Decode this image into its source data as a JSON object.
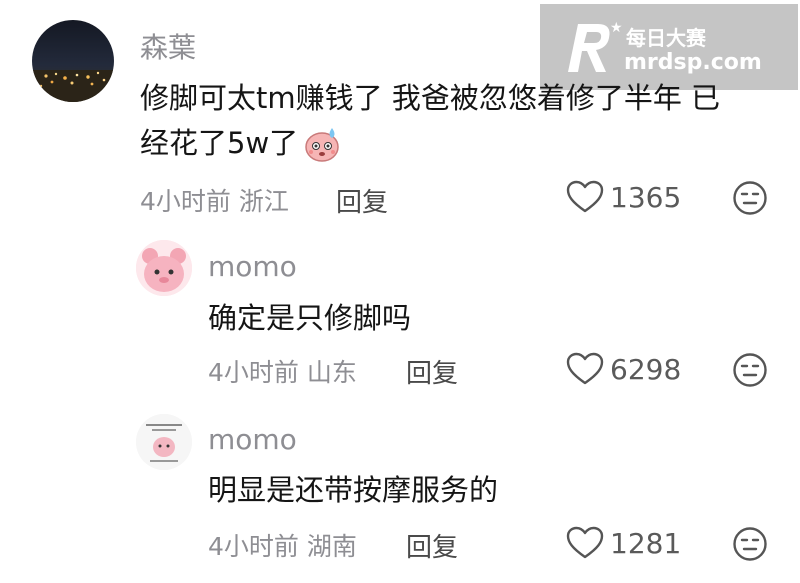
{
  "watermark": {
    "brand": "每日大赛",
    "url": "mrdsp.com"
  },
  "comments": [
    {
      "username": "森葉",
      "text_line1": "修脚可太tm赚钱了 我爸被忽悠着修了半年 已",
      "text_line2": "经花了5w了",
      "time": "4小时前",
      "location": "浙江",
      "reply_label": "回复",
      "likes": "1365"
    },
    {
      "username": "momo",
      "text": "确定是只修脚吗",
      "time": "4小时前",
      "location": "山东",
      "reply_label": "回复",
      "likes": "6298"
    },
    {
      "username": "momo",
      "text": "明显是还带按摩服务的",
      "time": "4小时前",
      "location": "湖南",
      "reply_label": "回复",
      "likes": "1281"
    }
  ]
}
